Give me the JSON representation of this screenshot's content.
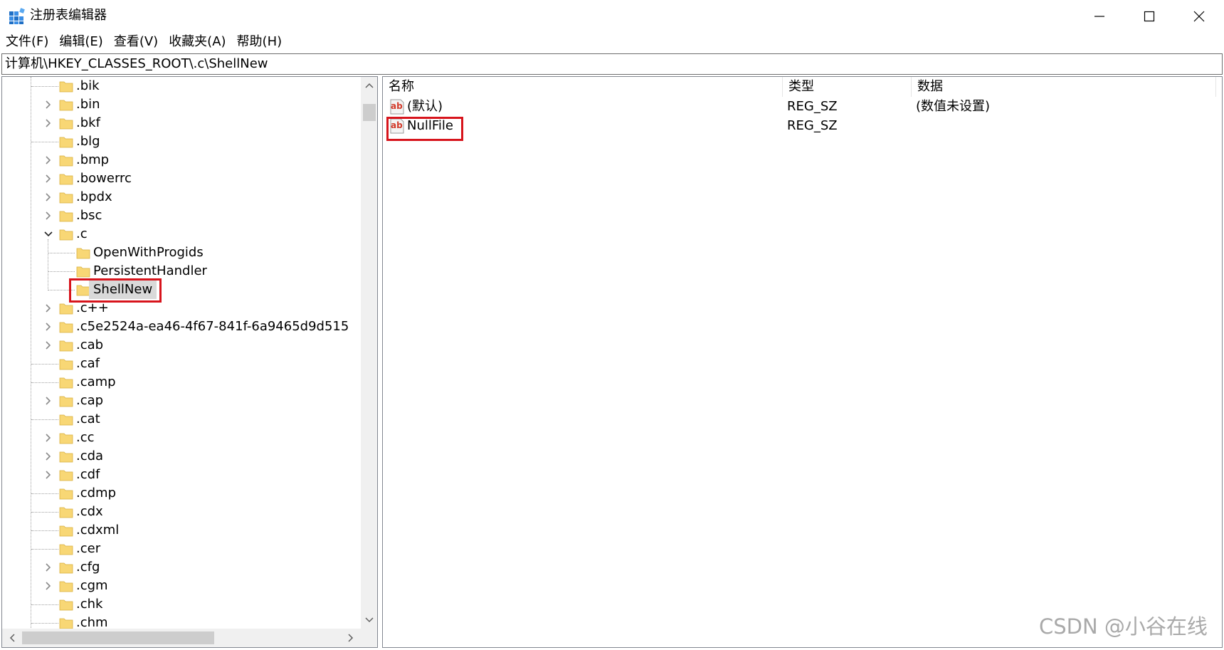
{
  "window": {
    "title": "注册表编辑器",
    "icon": "regedit-icon"
  },
  "menu": [
    {
      "label": "文件(F)"
    },
    {
      "label": "编辑(E)"
    },
    {
      "label": "查看(V)"
    },
    {
      "label": "收藏夹(A)"
    },
    {
      "label": "帮助(H)"
    }
  ],
  "address": {
    "path": "计算机\\HKEY_CLASSES_ROOT\\.c\\ShellNew"
  },
  "tree": {
    "items": [
      {
        "label": ".bik",
        "expandable": false
      },
      {
        "label": ".bin",
        "expandable": true
      },
      {
        "label": ".bkf",
        "expandable": true
      },
      {
        "label": ".blg",
        "expandable": false
      },
      {
        "label": ".bmp",
        "expandable": true
      },
      {
        "label": ".bowerrc",
        "expandable": true
      },
      {
        "label": ".bpdx",
        "expandable": true
      },
      {
        "label": ".bsc",
        "expandable": true
      },
      {
        "label": ".c",
        "expandable": true,
        "expanded": true
      },
      {
        "label": "OpenWithProgids",
        "child": true
      },
      {
        "label": "PersistentHandler",
        "child": true
      },
      {
        "label": "ShellNew",
        "child": true,
        "selected": true
      },
      {
        "label": ".c++",
        "expandable": true
      },
      {
        "label": ".c5e2524a-ea46-4f67-841f-6a9465d9d515",
        "expandable": true
      },
      {
        "label": ".cab",
        "expandable": true
      },
      {
        "label": ".caf",
        "expandable": false
      },
      {
        "label": ".camp",
        "expandable": false
      },
      {
        "label": ".cap",
        "expandable": true
      },
      {
        "label": ".cat",
        "expandable": false
      },
      {
        "label": ".cc",
        "expandable": true
      },
      {
        "label": ".cda",
        "expandable": true
      },
      {
        "label": ".cdf",
        "expandable": true
      },
      {
        "label": ".cdmp",
        "expandable": false
      },
      {
        "label": ".cdx",
        "expandable": false
      },
      {
        "label": ".cdxml",
        "expandable": false
      },
      {
        "label": ".cer",
        "expandable": false
      },
      {
        "label": ".cfg",
        "expandable": true
      },
      {
        "label": ".cgm",
        "expandable": true
      },
      {
        "label": ".chk",
        "expandable": false
      },
      {
        "label": ".chm",
        "expandable": false
      }
    ]
  },
  "list": {
    "columns": [
      "名称",
      "类型",
      "数据"
    ],
    "rows": [
      {
        "name": "(默认)",
        "type": "REG_SZ",
        "data": "(数值未设置)"
      },
      {
        "name": "NullFile",
        "type": "REG_SZ",
        "data": "",
        "highlighted": true
      }
    ]
  },
  "colors": {
    "highlight": "#d7141c",
    "folder": "#f8d775",
    "selection": "#d9d9d9"
  },
  "watermark": "CSDN @小谷在线"
}
